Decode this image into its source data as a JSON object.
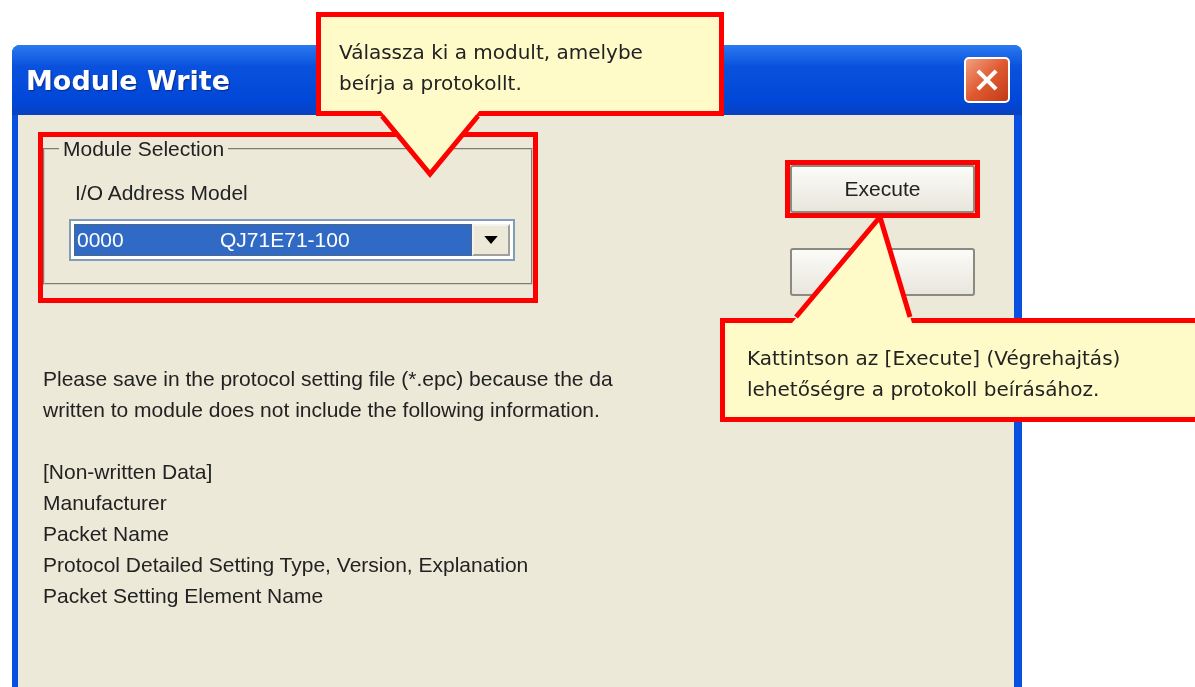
{
  "window": {
    "title": "Module Write"
  },
  "module_selection": {
    "legend": "Module Selection",
    "highlighted": true,
    "label": "I/O Address Model",
    "combo": {
      "io_address": "0000",
      "model": "QJ71E71-100",
      "selected": true
    }
  },
  "buttons": [
    {
      "label": "Execute",
      "highlighted": true
    },
    {
      "highlighted": false
    }
  ],
  "message": {
    "lines": [
      "Please save in the protocol setting file (*.epc) because the da",
      "written to module does not include the following information."
    ]
  },
  "non_written_data": [
    "[Non-written Data]",
    "Manufacturer",
    "Packet Name",
    "Protocol Detailed Setting Type, Version, Explanation",
    "Packet Setting Element Name"
  ],
  "callouts": [
    {
      "kind": "down",
      "lines": [
        "Válassza ki a modult, amelybe",
        "beírja a protokollt."
      ]
    },
    {
      "kind": "up",
      "lines": [
        "Kattintson az [Execute] (Végrehajtás)",
        "lehetőségre a protokoll beírásához."
      ]
    }
  ]
}
